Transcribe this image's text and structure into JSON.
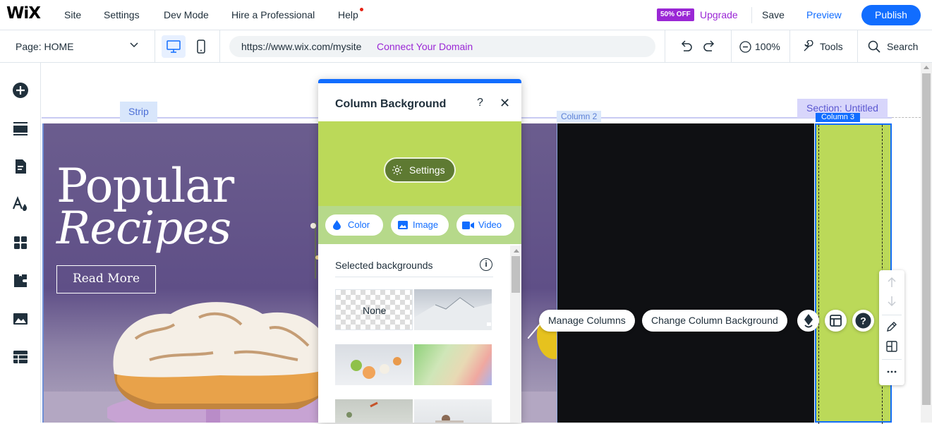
{
  "topbar": {
    "logo": "WiX",
    "menu": [
      "Site",
      "Settings",
      "Dev Mode",
      "Hire a Professional",
      "Help"
    ],
    "offer_badge": "50% OFF",
    "upgrade": "Upgrade",
    "save": "Save",
    "preview": "Preview",
    "publish": "Publish"
  },
  "toolbar2": {
    "page_selector": "Page: HOME",
    "url": "https://www.wix.com/mysite",
    "connect_domain": "Connect Your Domain",
    "zoom": "100%",
    "tools": "Tools",
    "search": "Search"
  },
  "left_toolbar": {
    "icons": [
      "add-icon",
      "sections-icon",
      "pages-icon",
      "design-icon",
      "apps-icon",
      "business-icon",
      "media-icon",
      "cms-icon"
    ]
  },
  "canvas": {
    "strip_label": "Strip",
    "section_label": "Section: Untitled",
    "column2_label": "Column 2",
    "column3_label": "Column 3",
    "hero_line1": "Popular",
    "hero_line2": "Recipes",
    "read_more": "Read More"
  },
  "panel": {
    "title": "Column Background",
    "help": "?",
    "close": "✕",
    "settings_button": "Settings",
    "tabs": [
      "Color",
      "Image",
      "Video"
    ],
    "section_label": "Selected backgrounds",
    "thumb_none": "None"
  },
  "actions": {
    "manage_columns": "Manage Columns",
    "change_background": "Change Column Background"
  },
  "colors": {
    "accent": "#116dff",
    "purple": "#9a27d5",
    "column_green": "#bbd959",
    "column_dark": "#0f1013"
  }
}
